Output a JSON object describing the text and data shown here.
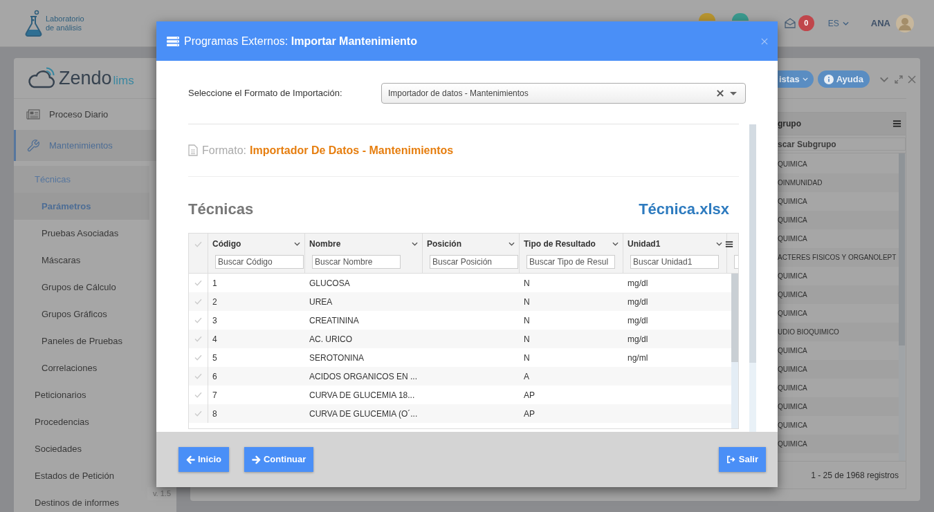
{
  "topbar": {
    "logo_lines": [
      "Laboratorio",
      "de análisis"
    ],
    "mail_count": "0",
    "language": "ES",
    "user": "ANA"
  },
  "sidebar": {
    "brand": "Zendo",
    "brand_suffix": "lims",
    "items": [
      {
        "label": "Proceso Diario",
        "selected": false
      },
      {
        "label": "Mantenimientos",
        "selected": true,
        "children": [
          {
            "label": "Técnicas",
            "selected": true,
            "children": [
              {
                "label": "Parámetros",
                "selected": true
              },
              {
                "label": "Pruebas Asociadas",
                "selected": false
              },
              {
                "label": "Máscaras",
                "selected": false
              },
              {
                "label": "Grupos de Cálculo",
                "selected": false
              },
              {
                "label": "Grupos Gráficos",
                "selected": false
              },
              {
                "label": "Paneles de Pruebas",
                "selected": false
              },
              {
                "label": "Correlaciones",
                "selected": false
              }
            ]
          },
          {
            "label": "Peticionarios",
            "selected": false
          },
          {
            "label": "Procedencias",
            "selected": false
          },
          {
            "label": "Sociedades",
            "selected": false
          },
          {
            "label": "Estados de Petición",
            "selected": false
          },
          {
            "label": "Destinos de informes",
            "selected": false
          }
        ]
      }
    ],
    "version": "v. 1.5"
  },
  "background_panel": {
    "buttons": [
      {
        "label": "istas",
        "kind": "dropdown"
      },
      {
        "label": "Ayuda",
        "kind": "help"
      }
    ],
    "grid": {
      "column_header": "grupo",
      "filter_placeholder": "scar Subgrupo",
      "rows": [
        "QUIMICA",
        "OINMUNIDAD",
        "QUIMICA",
        "QUIMICA",
        "QUIMICA",
        "ACTERES FISICOS Y ORGANOLEPT",
        "QUIMICA",
        "QUIMICA",
        "QUIMICA",
        "UDIO BIOQUIMICO",
        "QUIMICA",
        "QUIMICA",
        "QUIMICA",
        "QUIMICA",
        "QUIMICA",
        "QUIMICA"
      ],
      "footer": "1 - 25 de 1968 registros"
    }
  },
  "modal": {
    "title": "Programas Externos: **Importar Mantenimiento**",
    "format_select": {
      "label": "Seleccione el Formato de Importación:",
      "value": "Importador de datos - Mantenimientos"
    },
    "format": {
      "label": "Formato:",
      "value": "Importador De Datos - Mantenimientos"
    },
    "sheet": {
      "title": "Técnicas",
      "file": "Técnica.xlsx"
    },
    "table": {
      "columns": [
        {
          "label": "Código",
          "filter_placeholder": "Buscar Código"
        },
        {
          "label": "Nombre",
          "filter_placeholder": "Buscar Nombre"
        },
        {
          "label": "Posición",
          "filter_placeholder": "Buscar Posición"
        },
        {
          "label": "Tipo de Resultado",
          "filter_placeholder": "Buscar Tipo de Resul"
        },
        {
          "label": "Unidad1",
          "filter_placeholder": "Buscar Unidad1"
        }
      ],
      "rows": [
        {
          "selected": false,
          "code": "1",
          "name": "GLUCOSA",
          "result_type": "N",
          "unit1": "mg/dl"
        },
        {
          "selected": false,
          "code": "2",
          "name": "UREA",
          "result_type": "N",
          "unit1": "mg/dl"
        },
        {
          "selected": false,
          "code": "3",
          "name": "CREATININA",
          "result_type": "N",
          "unit1": "mg/dl"
        },
        {
          "selected": false,
          "code": "4",
          "name": "AC. URICO",
          "result_type": "N",
          "unit1": "mg/dl"
        },
        {
          "selected": false,
          "code": "5",
          "name": "SEROTONINA",
          "result_type": "N",
          "unit1": "ng/ml"
        },
        {
          "selected": false,
          "code": "6",
          "name": "ACIDOS ORGANICOS EN ...",
          "result_type": "A"
        },
        {
          "selected": false,
          "code": "7",
          "name": "CURVA DE GLUCEMIA 18...",
          "result_type": "AP"
        },
        {
          "selected": false,
          "code": "8",
          "name": "CURVA DE GLUCEMIA (O´...",
          "result_type": "AP"
        }
      ]
    },
    "buttons": [
      {
        "label": "Inicio",
        "kind": "back"
      },
      {
        "label": "Continuar",
        "kind": "next"
      },
      {
        "label": "Salir",
        "kind": "exit"
      }
    ]
  }
}
